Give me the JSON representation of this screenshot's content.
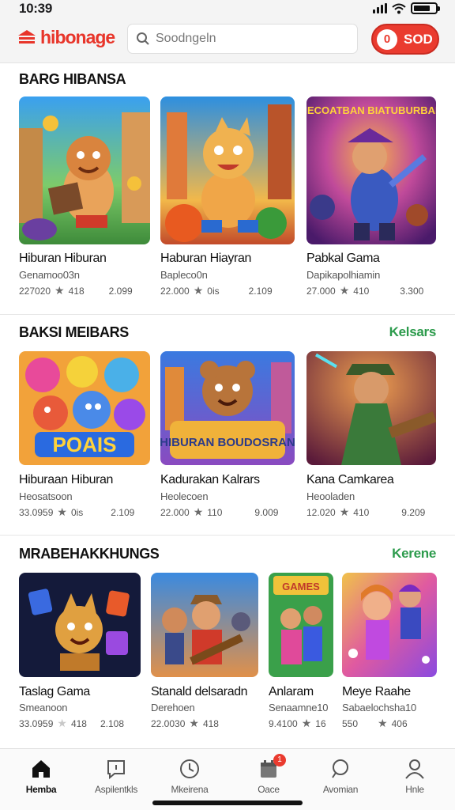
{
  "status": {
    "time": "10:39"
  },
  "header": {
    "logo_text": "hibonage",
    "search_placeholder": "Soodngeln",
    "signin_badge": "0",
    "signin_label": "SOD"
  },
  "sections": [
    {
      "title": "BARG HIBANSA",
      "see_more": "",
      "games": [
        {
          "title": "Hiburan Hiburan",
          "subtitle": "Genamoo03n",
          "count": "227020",
          "rating": "418",
          "extra": "2.099"
        },
        {
          "title": "Haburan Hiayran",
          "subtitle": "Bapleco0n",
          "count": "22.000",
          "rating": "0is",
          "extra": "2.109"
        },
        {
          "title": "Pabkal Gama",
          "subtitle": "Dapikapolhiamin",
          "count": "27.000",
          "rating": "410",
          "extra": "3.300",
          "art_text": "HECOATBAN BIATUBURBAN"
        }
      ]
    },
    {
      "title": "BAKSI MEIBARS",
      "see_more": "Kelsars",
      "games": [
        {
          "title": "Hiburaan Hiburan",
          "subtitle": "Heosatsoon",
          "count": "33.0959",
          "rating": "0is",
          "extra": "2.109",
          "art_text": "POAIS"
        },
        {
          "title": "Kadurakan Kalrars",
          "subtitle": "Heolecoen",
          "count": "22.000",
          "rating": "110",
          "extra": "9.009",
          "art_text": "HIBURAN BOUDOSRAN"
        },
        {
          "title": "Kana Camkarea",
          "subtitle": "Heooladen",
          "count": "12.020",
          "rating": "410",
          "extra": "9.209"
        }
      ]
    },
    {
      "title": "MRABEHAKKHUNGS",
      "see_more": "Kerene",
      "games": [
        {
          "title": "Taslag Gama",
          "subtitle": "Smeanoon",
          "count": "33.0959",
          "rating": "418",
          "extra": "2.108"
        },
        {
          "title": "Stanald delsaradn",
          "subtitle": "Derehoen",
          "count": "22.0030",
          "rating": "418",
          "extra": ""
        },
        {
          "title": "Anlaram",
          "subtitle": "Senaamne10",
          "count": "9.4100",
          "rating": "16",
          "extra": "",
          "art_text": "GAMES"
        },
        {
          "title": "Meye Raahe",
          "subtitle": "Sabaelochsha10",
          "count": "550",
          "rating": "406",
          "extra": ""
        }
      ]
    }
  ],
  "nav": [
    {
      "label": "Hemba",
      "icon": "home-icon"
    },
    {
      "label": "Aspilentkls",
      "icon": "message-icon"
    },
    {
      "label": "Mkeirena",
      "icon": "clock-icon"
    },
    {
      "label": "Oace",
      "icon": "calendar-icon",
      "badge": "1"
    },
    {
      "label": "Avomian",
      "icon": "chat-search-icon"
    },
    {
      "label": "Hnle",
      "icon": "profile-icon"
    }
  ],
  "colors": {
    "brand_red": "#ea3b2f",
    "link_green": "#2c9b4c"
  }
}
